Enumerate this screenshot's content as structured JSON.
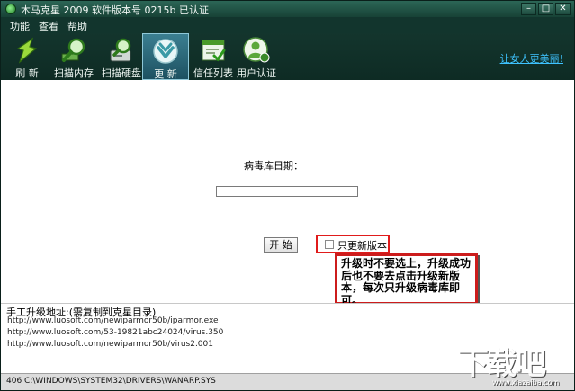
{
  "window": {
    "title": "木马克星 2009  软件版本号 0215b  已认证",
    "controls": [
      "–",
      "□",
      "✕"
    ]
  },
  "menu": [
    "功能",
    "查看",
    "帮助"
  ],
  "toolbar": {
    "buttons": [
      {
        "label": "刷 新",
        "icon": "refresh-icon"
      },
      {
        "label": "扫描内存",
        "icon": "scan-memory-icon"
      },
      {
        "label": "扫描硬盘",
        "icon": "scan-disk-icon"
      },
      {
        "label": "更 新",
        "icon": "update-icon",
        "active": true
      },
      {
        "label": "信任列表",
        "icon": "trust-list-icon"
      },
      {
        "label": "用户认证",
        "icon": "user-auth-icon"
      }
    ],
    "brand_link": "让女人更美丽!"
  },
  "update": {
    "date_label": "病毒库日期：",
    "date_value": "",
    "start_label": "开 始",
    "update_only_label": "只更新版本",
    "annotation": "升级时不要选上，升级成功后也不要去点击升级新版本，每次只升级病毒库即可。"
  },
  "manual": {
    "title": "手工升级地址:(需复制到克星目录)",
    "urls": [
      "http://www.luosoft.com/newiparmor50b/iparmor.exe",
      "http://www.luosoft.com/53-19821abc24024/virus.350",
      "http://www.luosoft.com/newiparmor50b/virus2.001"
    ]
  },
  "status": {
    "text": "406  C:\\WINDOWS\\SYSTEM32\\DRIVERS\\WANARP.SYS"
  },
  "watermark": {
    "text": "下载吧",
    "url": "www.xiazaiba.com"
  },
  "colors": {
    "chrome": "#173c33",
    "active_tab": "#2d6f82",
    "highlight": "#e01b1b",
    "link": "#3ec3ff"
  }
}
